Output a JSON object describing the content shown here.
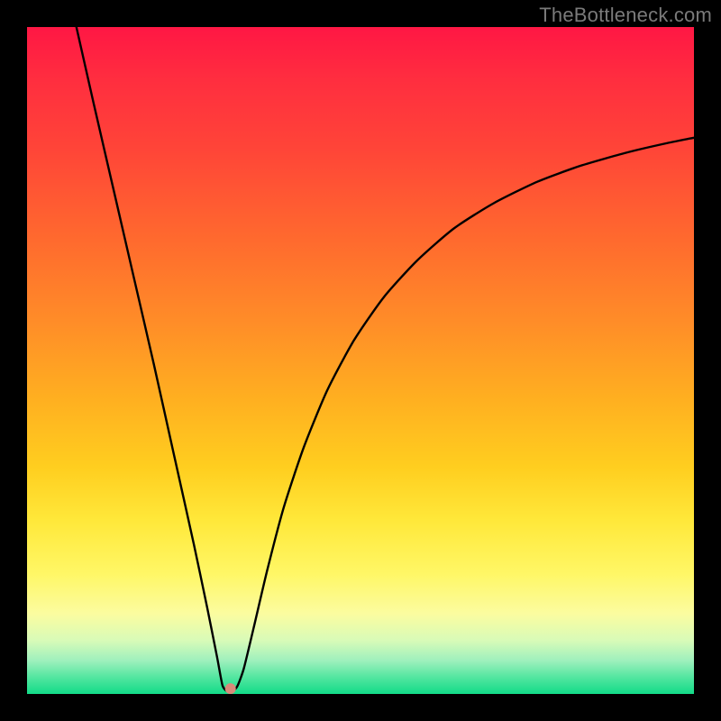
{
  "attribution": "TheBottleneck.com",
  "chart_data": {
    "type": "line",
    "title": "",
    "xlabel": "",
    "ylabel": "",
    "xlim": [
      0,
      100
    ],
    "ylim": [
      0,
      100
    ],
    "notch_x": 30,
    "notch_point": {
      "x": 30.5,
      "y": 0.8,
      "color": "#d98a7a",
      "radius_px": 6
    },
    "curve_points": [
      {
        "x": 7.4,
        "y": 100.0
      },
      {
        "x": 10.0,
        "y": 88.5
      },
      {
        "x": 13.0,
        "y": 75.5
      },
      {
        "x": 16.0,
        "y": 62.5
      },
      {
        "x": 19.0,
        "y": 49.5
      },
      {
        "x": 22.0,
        "y": 36.0
      },
      {
        "x": 25.0,
        "y": 22.5
      },
      {
        "x": 27.0,
        "y": 13.0
      },
      {
        "x": 28.5,
        "y": 5.5
      },
      {
        "x": 29.3,
        "y": 1.3
      },
      {
        "x": 30.0,
        "y": 0.4
      },
      {
        "x": 30.7,
        "y": 0.4
      },
      {
        "x": 31.5,
        "y": 1.1
      },
      {
        "x": 32.5,
        "y": 3.8
      },
      {
        "x": 34.0,
        "y": 10.0
      },
      {
        "x": 36.0,
        "y": 18.5
      },
      {
        "x": 38.5,
        "y": 28.0
      },
      {
        "x": 41.5,
        "y": 37.0
      },
      {
        "x": 45.0,
        "y": 45.5
      },
      {
        "x": 49.0,
        "y": 53.0
      },
      {
        "x": 53.5,
        "y": 59.5
      },
      {
        "x": 58.5,
        "y": 65.0
      },
      {
        "x": 64.0,
        "y": 69.8
      },
      {
        "x": 70.0,
        "y": 73.6
      },
      {
        "x": 76.5,
        "y": 76.8
      },
      {
        "x": 83.0,
        "y": 79.2
      },
      {
        "x": 90.0,
        "y": 81.2
      },
      {
        "x": 96.0,
        "y": 82.6
      },
      {
        "x": 100.0,
        "y": 83.4
      }
    ],
    "background_gradient": {
      "direction": "vertical",
      "stops": [
        {
          "pos": 0.0,
          "color": "#ff1744"
        },
        {
          "pos": 0.5,
          "color": "#ffb020"
        },
        {
          "pos": 0.82,
          "color": "#fff766"
        },
        {
          "pos": 1.0,
          "color": "#12db88"
        }
      ]
    }
  }
}
